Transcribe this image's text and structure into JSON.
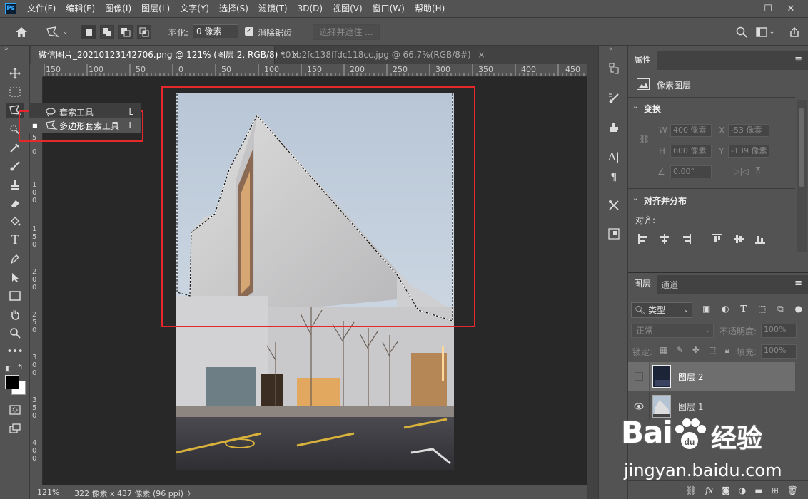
{
  "app": {
    "logo": "Ps"
  },
  "menu": [
    "文件(F)",
    "编辑(E)",
    "图像(I)",
    "图层(L)",
    "文字(Y)",
    "选择(S)",
    "滤镜(T)",
    "3D(D)",
    "视图(V)",
    "窗口(W)",
    "帮助(H)"
  ],
  "window_controls": {
    "minimize": "—",
    "restore": "☐",
    "close": "✕"
  },
  "options": {
    "feather_label": "羽化:",
    "feather_value": "0 像素",
    "antialias_label": "消除锯齿",
    "antialias_checked": true,
    "select_mask_label": "选择并遮住 ..."
  },
  "tabs": [
    {
      "label": "微信图片_20210123142706.png @ 121% (图层 2, RGB/8) *",
      "close": "×",
      "active": true
    },
    {
      "label": "t01b2fc138ffdc118cc.jpg @ 66.7%(RGB/8#)",
      "close": "×",
      "active": false
    }
  ],
  "ruler_h": [
    "150",
    "100",
    "50",
    "0",
    "50",
    "100",
    "150",
    "200",
    "250",
    "300",
    "350",
    "400",
    "450"
  ],
  "ruler_v": [
    "5",
    "0",
    "1 0 0",
    "1 5 0",
    "2 0 0",
    "2 5 0",
    "3 0 0",
    "3 5 0",
    "4 0 0"
  ],
  "flyout": {
    "items": [
      {
        "label": "套索工具",
        "key": "L",
        "current": false
      },
      {
        "label": "多边形套索工具",
        "key": "L",
        "current": true
      }
    ]
  },
  "status": {
    "zoom": "121%",
    "info": "322 像素 x 437 像素 (96 ppi)",
    "arrow": "〉"
  },
  "properties": {
    "title": "属性",
    "type_label": "像素图层",
    "transform_title": "变换",
    "w_label": "W",
    "w_value": "400 像素",
    "x_label": "X",
    "x_value": "-53 像素",
    "h_label": "H",
    "h_value": "600 像素",
    "y_label": "Y",
    "y_value": "-139 像素",
    "angle_value": "0.00°",
    "align_title": "对齐并分布",
    "align_label": "对齐:"
  },
  "layers_panel": {
    "tab_layers": "图层",
    "tab_channels": "通道",
    "filter_label": "类型",
    "blend_mode": "正常",
    "opacity_label": "不透明度:",
    "opacity_value": "100%",
    "lock_label": "锁定:",
    "fill_label": "填充:",
    "fill_value": "100%",
    "layers": [
      {
        "name": "图层 2",
        "visible": false,
        "selected": true
      },
      {
        "name": "图层 1",
        "visible": true,
        "selected": false
      }
    ]
  },
  "watermark": {
    "brand": "Bai",
    "brand2": "经验",
    "url": "jingyan.baidu.com"
  },
  "colors": {
    "accent_red": "#e5282c",
    "ps_blue": "#31a8ff",
    "panel_bg": "#535353",
    "canvas_bg": "#282828"
  }
}
